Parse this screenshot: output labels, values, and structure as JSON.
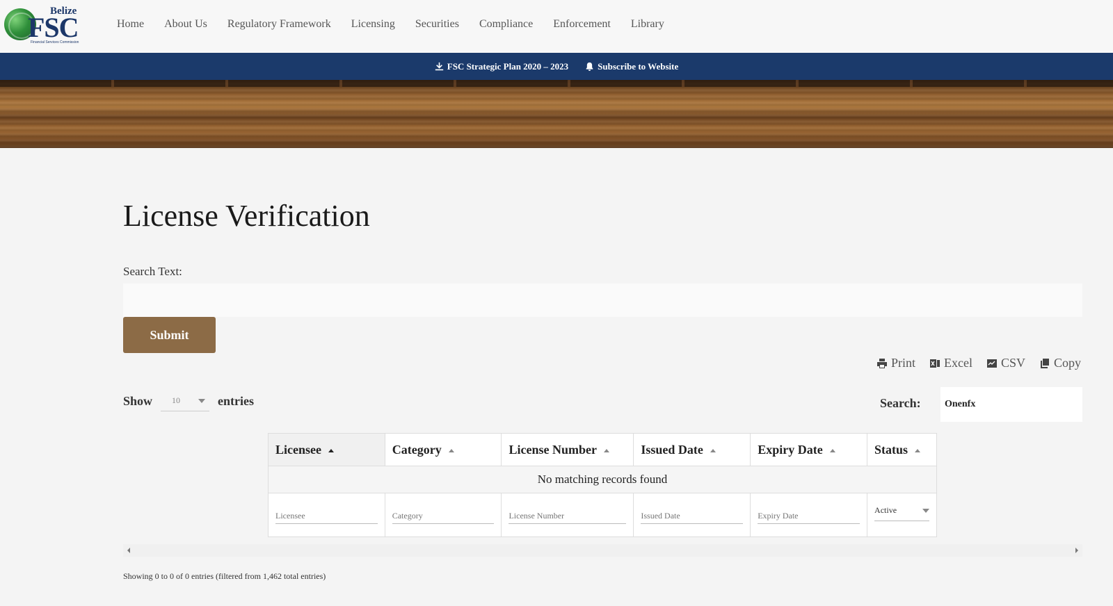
{
  "logo": {
    "top": "Belize",
    "main": "FSC",
    "sub": "Financial Services Commission"
  },
  "nav": [
    "Home",
    "About Us",
    "Regulatory Framework",
    "Licensing",
    "Securities",
    "Compliance",
    "Enforcement",
    "Library"
  ],
  "banner": {
    "strategic_plan": "FSC Strategic Plan 2020 – 2023",
    "subscribe": "Subscribe to Website"
  },
  "page": {
    "title": "License Verification",
    "search_label": "Search Text:",
    "search_value": "",
    "submit": "Submit"
  },
  "exports": {
    "print": "Print",
    "excel": "Excel",
    "csv": "CSV",
    "copy": "Copy"
  },
  "table_controls": {
    "show": "Show",
    "entries_value": "10",
    "entries": "entries",
    "search_label": "Search:",
    "search_value": "Onenfx"
  },
  "table": {
    "headers": [
      "Licensee",
      "Category",
      "License Number",
      "Issued Date",
      "Expiry Date",
      "Status"
    ],
    "empty_message": "No matching records found",
    "filters": {
      "licensee": "Licensee",
      "category": "Category",
      "license_number": "License Number",
      "issued_date": "Issued Date",
      "expiry_date": "Expiry Date",
      "status": "Active"
    }
  },
  "info": "Showing 0 to 0 of 0 entries (filtered from 1,462 total entries)",
  "colors": {
    "nav_blue": "#1b3a6b",
    "submit_brown": "#8c6b46"
  }
}
